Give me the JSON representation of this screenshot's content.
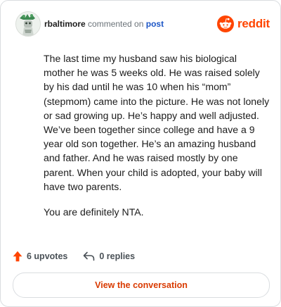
{
  "comment": {
    "username": "rbaltimore",
    "action_text": "commented on",
    "post_link": "post",
    "paragraphs": [
      "The last time my husband saw his biological mother he was 5 weeks old. He was raised solely by his dad until he was 10 when his “mom” (stepmom) came into the picture. He was not lonely or sad growing up. He’s happy and well adjusted. We’ve been together since college and have a 9 year old son together. He’s an amazing husband and father. And he was raised mostly by one parent. When your child is adopted, your baby will have two parents.",
      "You are definitely NTA."
    ]
  },
  "brand": {
    "icon": "reddit-snoo-icon",
    "wordmark": "reddit",
    "color": "#ff4500"
  },
  "stats": {
    "upvotes_label": "6 upvotes",
    "replies_label": "0 replies",
    "upvote_icon": "upvote-arrow-icon",
    "reply_icon": "reply-arrow-icon",
    "upvote_color": "#ff4500"
  },
  "cta": {
    "label": "View the conversation",
    "color": "#d93a00"
  }
}
